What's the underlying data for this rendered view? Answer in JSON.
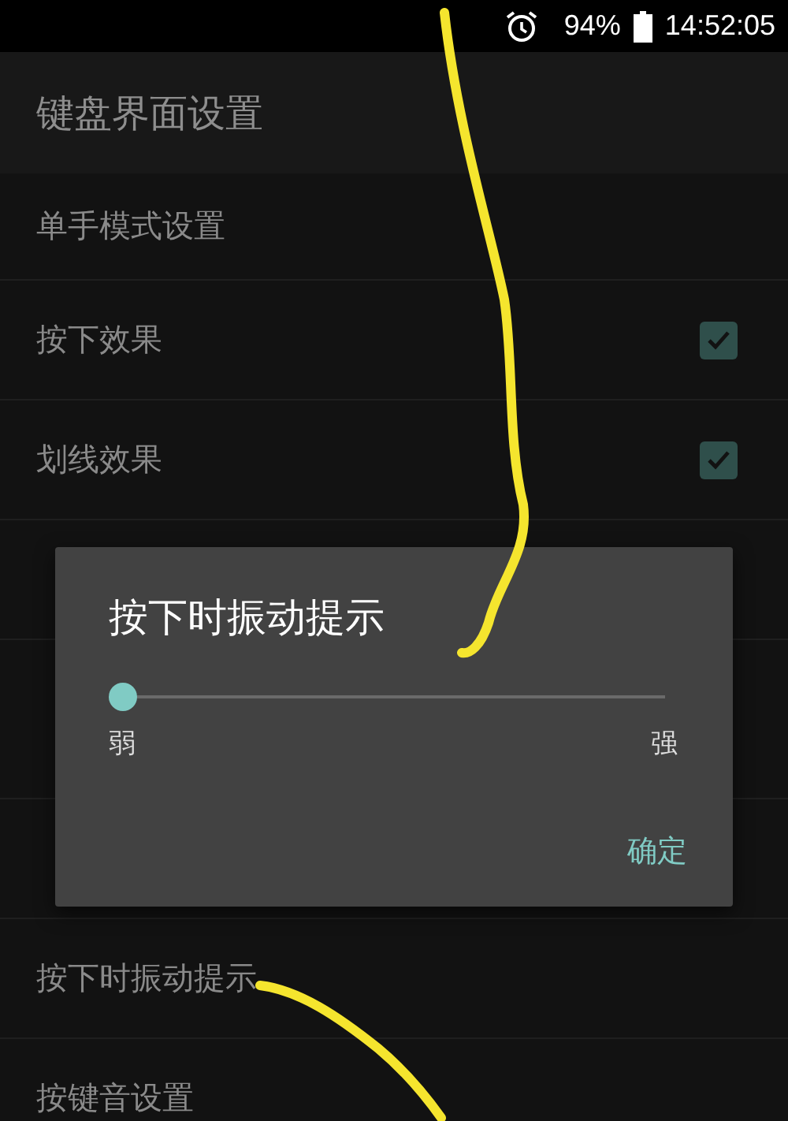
{
  "status_bar": {
    "battery": "94%",
    "time": "14:52:05"
  },
  "header": {
    "title": "键盘界面设置"
  },
  "settings": [
    {
      "kind": "plain",
      "title": "单手模式设置"
    },
    {
      "kind": "check",
      "title": "按下效果",
      "checked": true
    },
    {
      "kind": "check",
      "title": "划线效果",
      "checked": true
    },
    {
      "kind": "covered"
    },
    {
      "kind": "covered_tall"
    },
    {
      "kind": "covered"
    },
    {
      "kind": "plain",
      "title": "按下时振动提示"
    },
    {
      "kind": "plain",
      "title": "按键音设置"
    }
  ],
  "dialog": {
    "title": "按下时振动提示",
    "slider": {
      "level": 0,
      "min_label": "弱",
      "max_label": "强"
    },
    "button": "确定"
  }
}
